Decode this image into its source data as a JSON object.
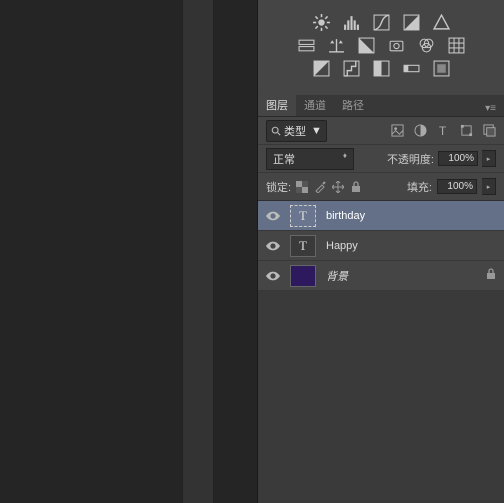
{
  "tabs": {
    "layers": "图层",
    "channels": "通道",
    "paths": "路径"
  },
  "filter": {
    "kind": "类型"
  },
  "blend": {
    "mode": "正常",
    "opacity_label": "不透明度:",
    "opacity_value": "100%"
  },
  "lock": {
    "label": "锁定:",
    "fill_label": "填充:",
    "fill_value": "100%"
  },
  "layers": [
    {
      "name": "birthday",
      "type": "text",
      "selected": true
    },
    {
      "name": "Happy",
      "type": "text",
      "selected": false
    },
    {
      "name": "背景",
      "type": "bg",
      "selected": false,
      "locked": true
    }
  ]
}
